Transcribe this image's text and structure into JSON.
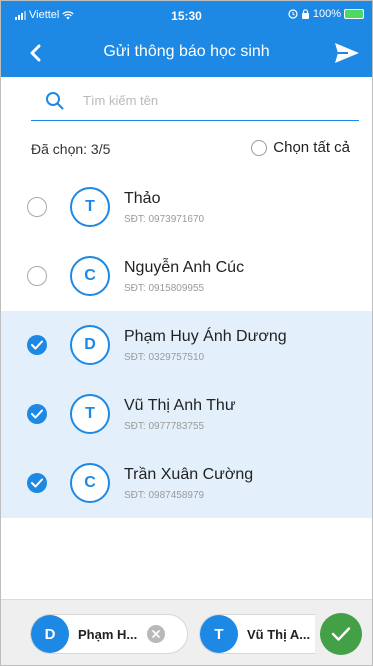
{
  "status_bar": {
    "carrier": "Viettel",
    "time": "15:30",
    "battery": "100%"
  },
  "header": {
    "title": "Gửi thông báo học sinh",
    "color": "#1e88e5"
  },
  "search": {
    "placeholder": "Tìm kiếm tên",
    "value": ""
  },
  "selection": {
    "count_label": "Đã chọn: 3/5",
    "select_all_label": "Chọn tất cả"
  },
  "students": [
    {
      "initial": "T",
      "name": "Thảo",
      "phone": "SĐT: 0973971670",
      "checked": false
    },
    {
      "initial": "C",
      "name": "Nguyễn Anh Cúc",
      "phone": "SĐT: 0915809955",
      "checked": false
    },
    {
      "initial": "D",
      "name": "Phạm Huy Ánh Dương",
      "phone": "SĐT: 0329757510",
      "checked": true
    },
    {
      "initial": "T",
      "name": "Vũ Thị Anh Thư",
      "phone": "SĐT: 0977783755",
      "checked": true
    },
    {
      "initial": "C",
      "name": "Trần Xuân Cường",
      "phone": "SĐT: 0987458979",
      "checked": true
    }
  ],
  "selected_chips": [
    {
      "initial": "D",
      "label": "Phạm H..."
    },
    {
      "initial": "T",
      "label": "Vũ Thị A..."
    }
  ],
  "colors": {
    "accent": "#1e88e5",
    "selected_row": "#e3f0fb",
    "confirm": "#43a047"
  }
}
